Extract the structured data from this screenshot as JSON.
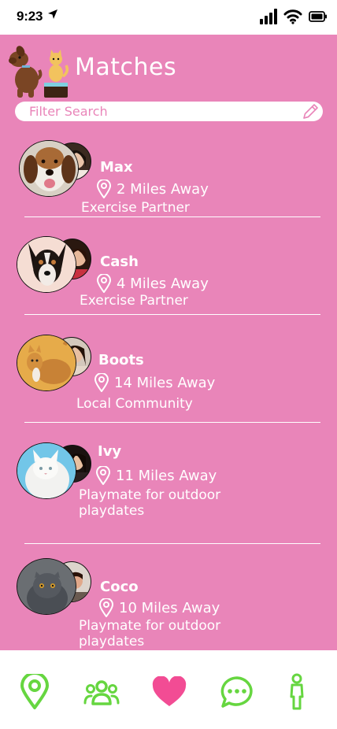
{
  "status_bar": {
    "time": "9:23"
  },
  "header": {
    "title": "Matches"
  },
  "search": {
    "placeholder": "Filter Search"
  },
  "matches": [
    {
      "name": "Max",
      "distance": "2 Miles Away",
      "purpose": "Exercise Partner"
    },
    {
      "name": "Cash",
      "distance": "4 Miles Away",
      "purpose": "Exercise Partner"
    },
    {
      "name": "Boots",
      "distance": "14 Miles Away",
      "purpose": "Local Community"
    },
    {
      "name": "Ivy",
      "distance": "11 Miles Away",
      "purpose": "Playmate for outdoor playdates"
    },
    {
      "name": "Coco",
      "distance": "10 Miles Away",
      "purpose": "Playmate for outdoor playdates"
    }
  ],
  "bottom_nav": {
    "items": [
      {
        "icon": "map-pin-icon"
      },
      {
        "icon": "group-icon"
      },
      {
        "icon": "heart-icon",
        "active": true
      },
      {
        "icon": "chat-icon"
      },
      {
        "icon": "person-icon"
      }
    ]
  },
  "colors": {
    "background": "#e985b9",
    "nav_green": "#66d640",
    "heart_pink": "#f24c94"
  }
}
